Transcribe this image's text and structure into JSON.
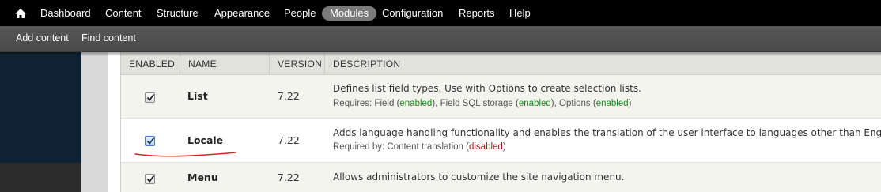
{
  "toolbar": {
    "items": [
      "Dashboard",
      "Content",
      "Structure",
      "Appearance",
      "People",
      "Modules",
      "Configuration",
      "Reports",
      "Help"
    ],
    "active": "Modules"
  },
  "shortcuts": [
    "Add content",
    "Find content"
  ],
  "table": {
    "headers": [
      "ENABLED",
      "NAME",
      "VERSION",
      "DESCRIPTION"
    ],
    "rows": [
      {
        "name": "List",
        "version": "7.22",
        "enabled": true,
        "description": "Defines list field types. Use with Options to create selection lists.",
        "req_prefix": "Requires: ",
        "req_parts": [
          {
            "name": "Field",
            "status": "enabled"
          },
          {
            "name": "Field SQL storage",
            "status": "enabled"
          },
          {
            "name": "Options",
            "status": "enabled"
          }
        ]
      },
      {
        "name": "Locale",
        "version": "7.22",
        "enabled": true,
        "description": "Adds language handling functionality and enables the translation of the user interface to languages other than English.",
        "req_prefix": "Required by: ",
        "req_parts": [
          {
            "name": "Content translation",
            "status": "disabled"
          }
        ]
      },
      {
        "name": "Menu",
        "version": "7.22",
        "enabled": true,
        "description": "Allows administrators to customize the site navigation menu."
      }
    ]
  },
  "colors": {
    "enabled": "#1e8a1e",
    "disabled": "#a11b1b",
    "annotation": "#e02020"
  },
  "icons": {
    "home": "home-icon",
    "checkbox": "checkmark-icon"
  }
}
